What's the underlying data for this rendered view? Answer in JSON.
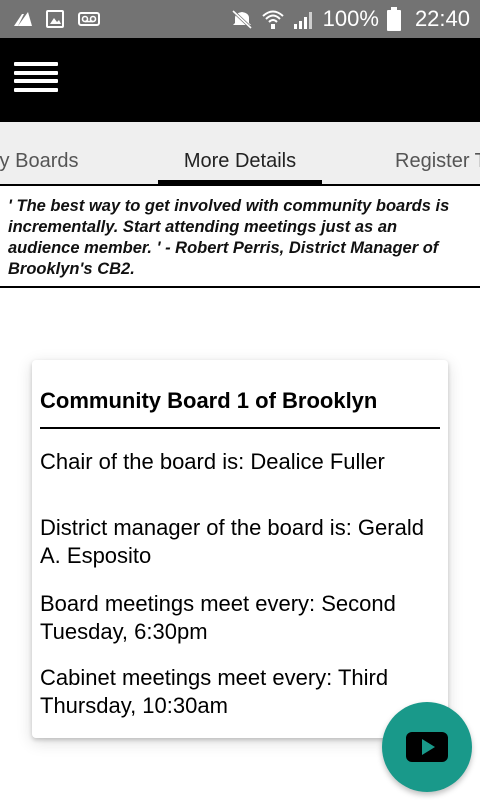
{
  "status_bar": {
    "battery_percent": "100%",
    "time": "22:40",
    "icons": [
      "signal-bars-icon",
      "image-icon",
      "voicemail-icon",
      "mute-icon",
      "wifi-icon",
      "cell-signal-icon",
      "battery-icon"
    ]
  },
  "app_bar": {
    "menu_icon": "hamburger-menu-icon",
    "background": "#000000"
  },
  "tabs": [
    {
      "label": "ty Boards",
      "active": false
    },
    {
      "label": "More Details",
      "active": true
    },
    {
      "label": "Register T",
      "active": false
    }
  ],
  "quote": {
    "text": "' The best way to get involved with community boards is incrementally. Start attending meetings just as an audience member. ' - Robert Perris, District Manager of Brooklyn's CB2."
  },
  "card": {
    "title": "Community Board 1 of Brooklyn",
    "chair": "Chair of the board is: Dealice Fuller",
    "district_manager": "District manager of the board is: Gerald A. Esposito",
    "board_meetings": "Board meetings meet every: Second Tuesday, 6:30pm",
    "cabinet_meetings": "Cabinet meetings meet every: Third Thursday, 10:30am"
  },
  "fab": {
    "icon": "play-icon",
    "color": "#19998a"
  }
}
